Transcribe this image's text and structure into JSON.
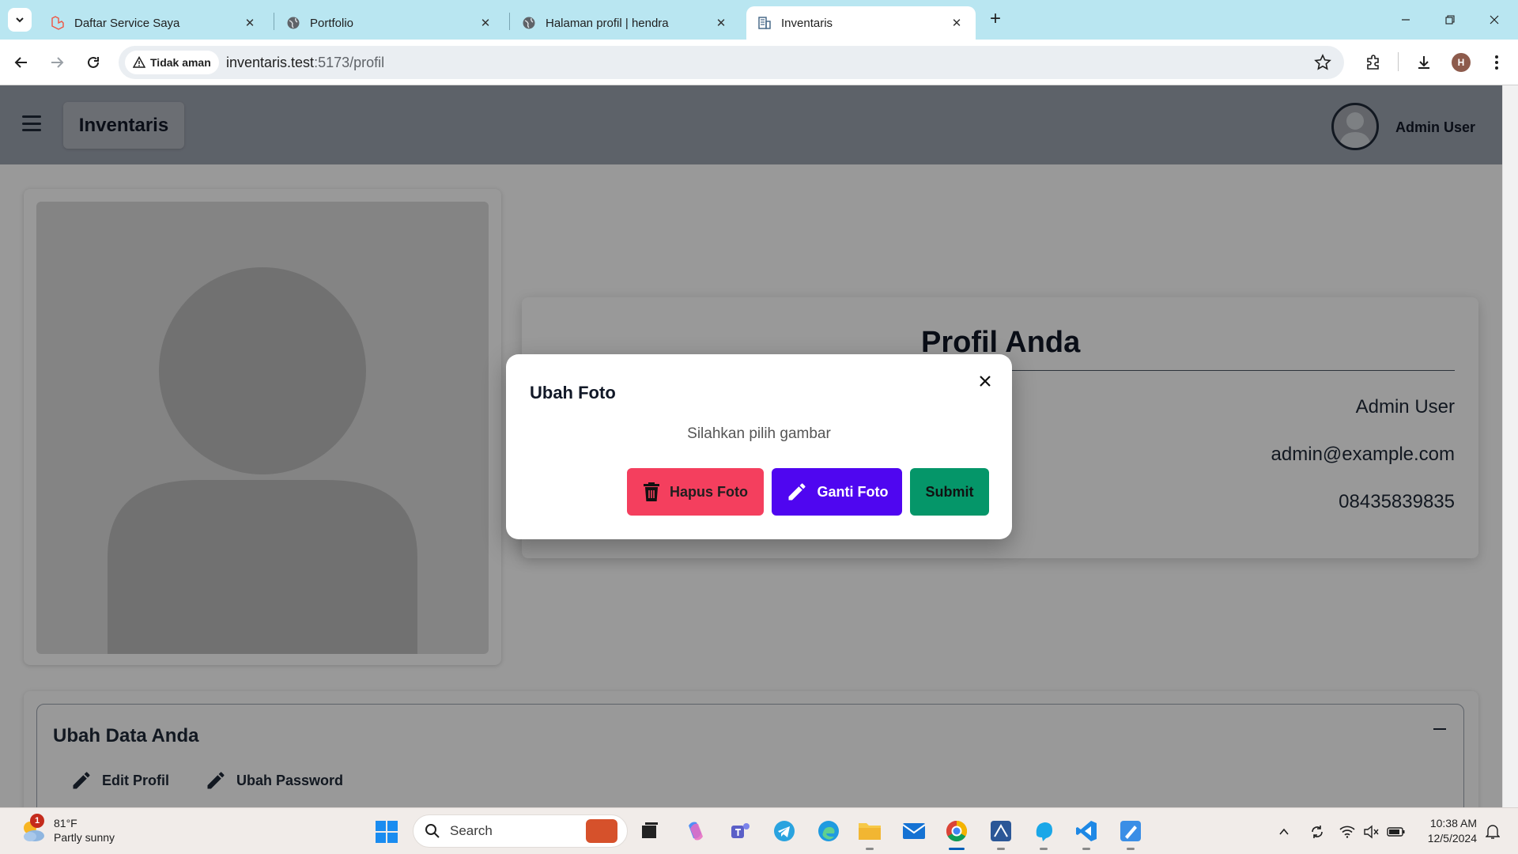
{
  "browser": {
    "tabs": [
      {
        "title": "Daftar Service Saya",
        "icon": "laravel-icon"
      },
      {
        "title": "Portfolio",
        "icon": "globe-icon"
      },
      {
        "title": "Halaman profil | hendra",
        "icon": "globe-icon"
      },
      {
        "title": "Inventaris",
        "icon": "building-icon",
        "active": true
      }
    ],
    "security_label": "Tidak aman",
    "url_host": "inventaris.test",
    "url_path": ":5173/profil",
    "profile_initial": "H"
  },
  "app": {
    "brand": "Inventaris",
    "user_name": "Admin User"
  },
  "profile": {
    "title": "Profil Anda",
    "name": "Admin User",
    "email": "admin@example.com",
    "phone": "08435839835"
  },
  "data_section": {
    "title": "Ubah Data Anda",
    "collapse_symbol": "−",
    "actions": [
      "Edit Profil",
      "Ubah Password"
    ]
  },
  "modal": {
    "title": "Ubah Foto",
    "message": "Silahkan pilih gambar",
    "delete_label": "Hapus Foto",
    "change_label": "Ganti Foto",
    "submit_label": "Submit"
  },
  "taskbar": {
    "weather_temp": "81°F",
    "weather_desc": "Partly sunny",
    "weather_badge": "1",
    "search_placeholder": "Search",
    "time": "10:38 AM",
    "date": "12/5/2024"
  },
  "colors": {
    "delete_button": "#f43f5e",
    "change_button": "#4f06f0",
    "submit_button": "#059669",
    "header": "#9ca3af"
  }
}
